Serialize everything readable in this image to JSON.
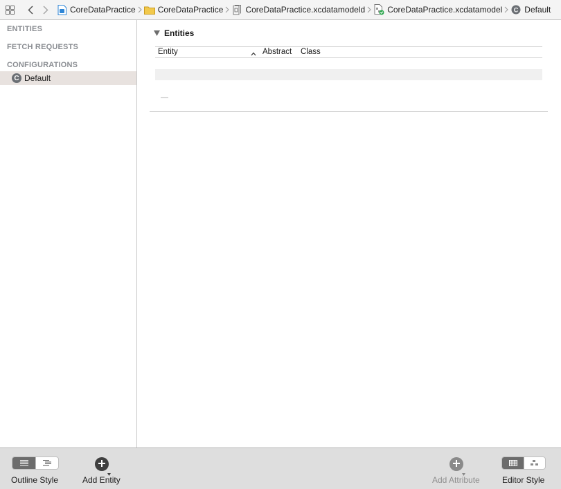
{
  "jumpbar": {
    "crumbs": [
      {
        "label": "CoreDataPractice",
        "icon": "project-file-icon"
      },
      {
        "label": "CoreDataPractice",
        "icon": "folder-icon"
      },
      {
        "label": "CoreDataPractice.xcdatamodeld",
        "icon": "model-bundle-icon"
      },
      {
        "label": "CoreDataPractice.xcdatamodel",
        "icon": "data-model-file-icon"
      },
      {
        "label": "Default",
        "icon": "configuration-icon"
      }
    ]
  },
  "outline": {
    "sections": [
      "ENTITIES",
      "FETCH REQUESTS",
      "CONFIGURATIONS"
    ],
    "configurations": [
      {
        "badge": "C",
        "label": "Default"
      }
    ]
  },
  "editor": {
    "section_title": "Entities",
    "columns": [
      "Entity",
      "Abstract",
      "Class"
    ],
    "rows": [],
    "remove_label": "—"
  },
  "bottombar": {
    "outline_style_label": "Outline Style",
    "add_entity_label": "Add Entity",
    "add_attribute_label": "Add Attribute",
    "editor_style_label": "Editor Style"
  },
  "colors": {
    "selection_row": "#e8e2df",
    "section_header": "#8a8d92",
    "bottom_bar": "#dedede",
    "segment_selected": "#6c6c6c"
  }
}
